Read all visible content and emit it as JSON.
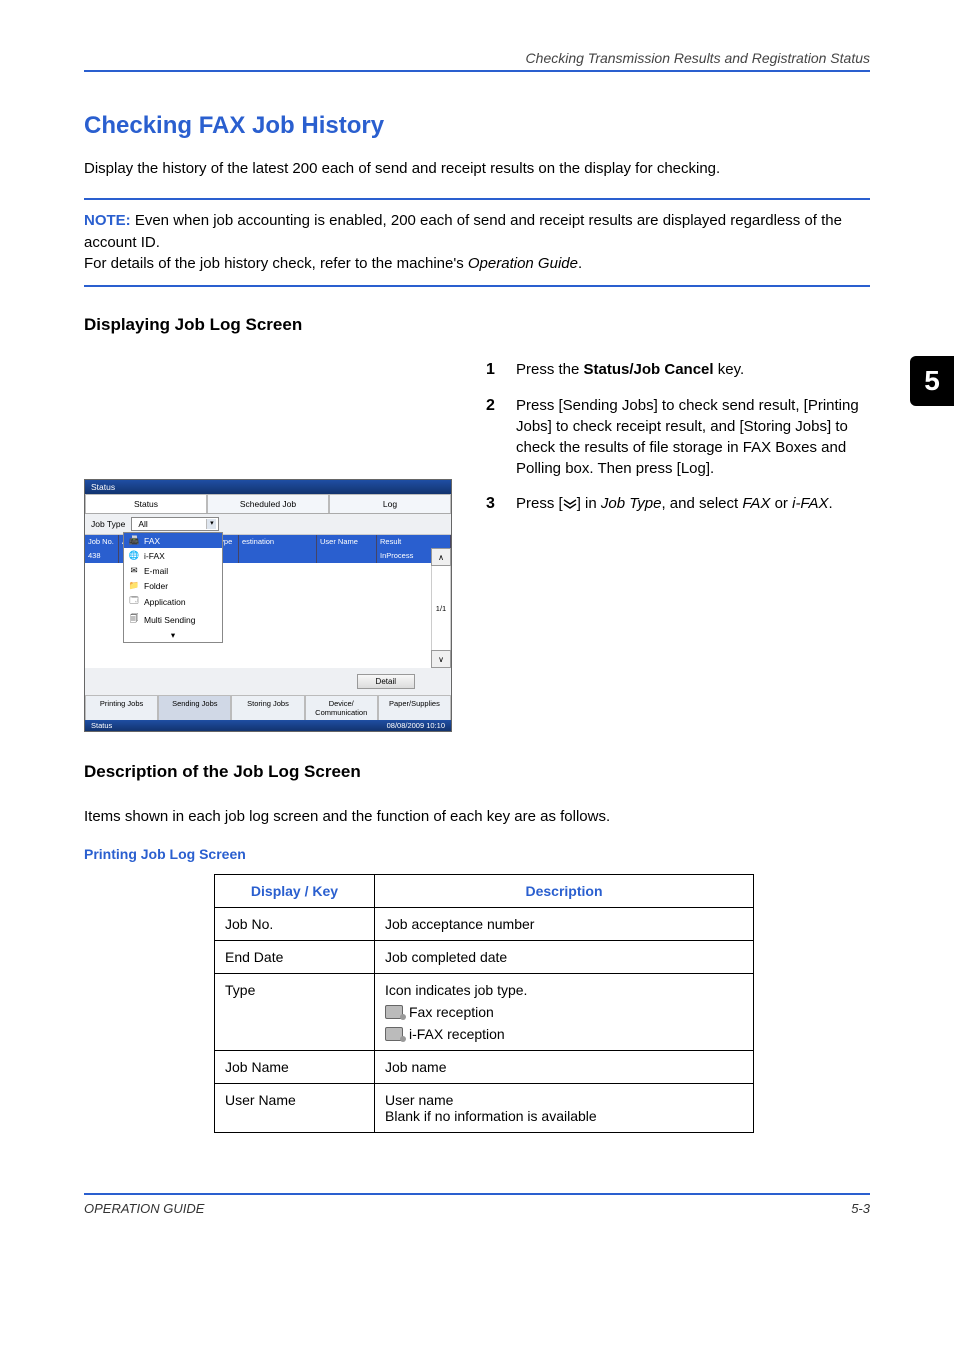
{
  "header": {
    "section_title": "Checking Transmission Results and Registration Status"
  },
  "main": {
    "heading": "Checking FAX Job History",
    "intro": "Display the history of the latest 200 each of send and receipt results on the display for checking."
  },
  "note": {
    "label": "NOTE:",
    "line1": " Even when job accounting is enabled, 200 each of send and receipt results are displayed regardless of the account ID.",
    "line2": "For details of the job history check, refer to the machine's ",
    "line2_em": "Operation Guide",
    "line2_tail": "."
  },
  "section1": {
    "heading": "Displaying Job Log Screen",
    "steps": [
      {
        "n": "1",
        "pre": "Press the ",
        "bold": "Status/Job Cancel",
        "post": " key."
      },
      {
        "n": "2",
        "pre": "Press [Sending Jobs] to check send result, [Printing Jobs] to check receipt result, and [Storing Jobs] to check the results of file storage in FAX Boxes and Polling box. Then press [Log].",
        "bold": "",
        "post": ""
      },
      {
        "n": "3",
        "pre": "Press [",
        "icon": "chevron-down",
        "mid": "] in ",
        "em1": "Job Type",
        "mid2": ", and select ",
        "em2": "FAX",
        "mid3": " or ",
        "em3": "i-FAX",
        "post": "."
      }
    ]
  },
  "section2": {
    "heading": "Description of the Job Log Screen",
    "lead": "Items shown in each job log screen and the function of each key are as follows.",
    "sub": "Printing Job Log Screen",
    "table": {
      "head": {
        "c1": "Display / Key",
        "c2": "Description"
      },
      "rows": [
        {
          "k": "Job No.",
          "v": "Job acceptance number"
        },
        {
          "k": "End Date",
          "v": "Job completed date"
        },
        {
          "k": "Type",
          "v": "Icon indicates job type.",
          "extra1": "Fax reception",
          "extra2": "i-FAX reception"
        },
        {
          "k": "Job Name",
          "v": "Job name"
        },
        {
          "k": "User Name",
          "v": "User name\nBlank if no information is available"
        }
      ]
    }
  },
  "screenshot": {
    "window_title": "Status",
    "tabs1": [
      "Status",
      "Scheduled Job",
      "Log"
    ],
    "jobtype_label": "Job Type",
    "jobtype_value": "All",
    "dropdown": [
      "FAX",
      "i-FAX",
      "E-mail",
      "Folder",
      "Application",
      "Multi Sending"
    ],
    "grid_headers": [
      "Job No.",
      "Accepted Time",
      "Type",
      "estination",
      "User Name",
      "Result"
    ],
    "grid_row": {
      "jobno": "438",
      "status": "InProcess"
    },
    "pager": "1/1",
    "detail_label": "Detail",
    "tabs2": [
      "Printing Jobs",
      "Sending Jobs",
      "Storing Jobs",
      "Device/\nCommunication",
      "Paper/Supplies"
    ],
    "footer_left": "Status",
    "footer_right": "08/08/2009   10:10"
  },
  "sidetab": "5",
  "footer": {
    "left": "OPERATION GUIDE",
    "right": "5-3"
  }
}
